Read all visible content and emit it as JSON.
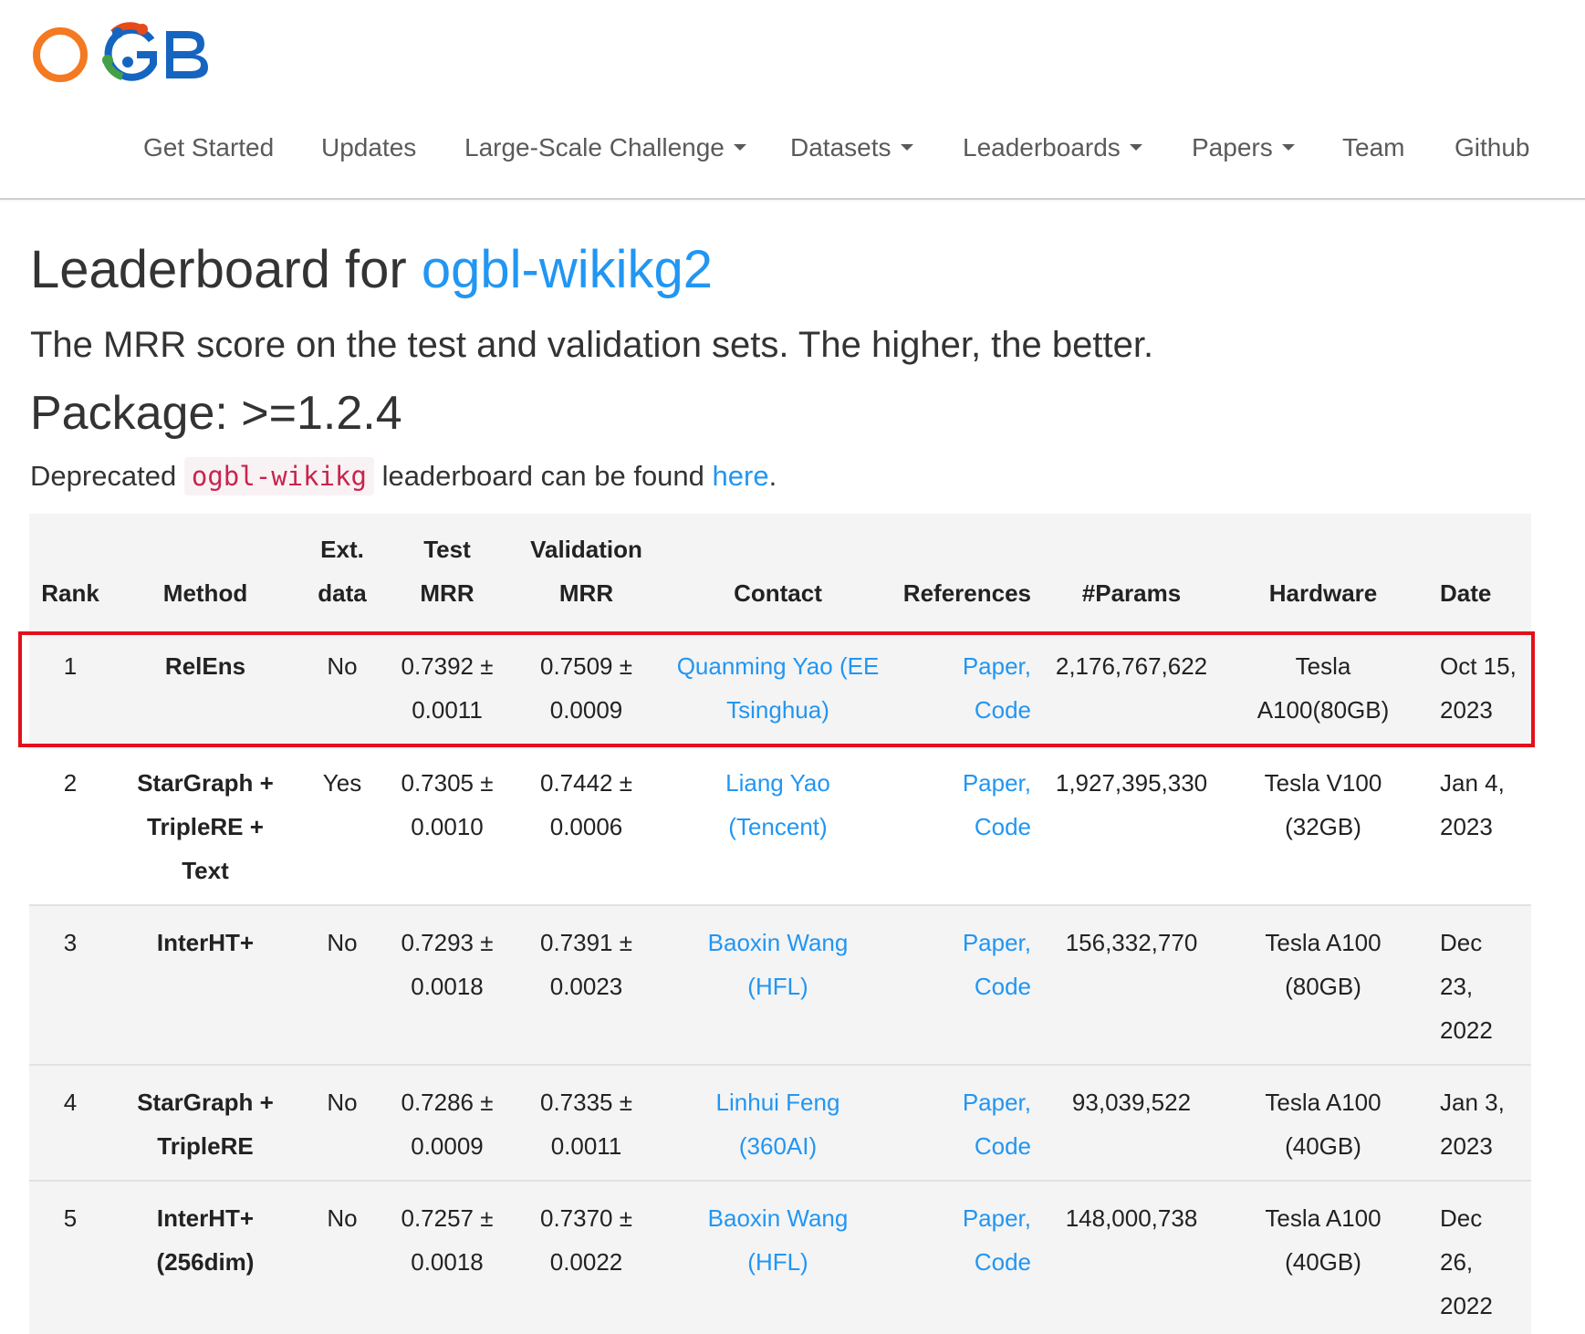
{
  "logo": {
    "text": "OGB"
  },
  "nav": {
    "items": [
      {
        "label": "Get Started",
        "dropdown": false
      },
      {
        "label": "Updates",
        "dropdown": false
      },
      {
        "label": "Large-Scale Challenge",
        "dropdown": true
      },
      {
        "label": "Datasets",
        "dropdown": true
      },
      {
        "label": "Leaderboards",
        "dropdown": true
      },
      {
        "label": "Papers",
        "dropdown": true
      },
      {
        "label": "Team",
        "dropdown": false
      },
      {
        "label": "Github",
        "dropdown": false
      }
    ]
  },
  "title": {
    "prefix": "Leaderboard for ",
    "dataset": "ogbl-wikikg2"
  },
  "subtitle": "The MRR score on the test and validation sets. The higher, the better.",
  "package": "Package: >=1.2.4",
  "deprecated": {
    "before": "Deprecated ",
    "code": "ogbl-wikikg",
    "middle": " leaderboard can be found ",
    "link": "here",
    "after": "."
  },
  "table": {
    "headers": {
      "rank": "Rank",
      "method": "Method",
      "ext_line1": "Ext.",
      "ext_line2": "data",
      "test_line1": "Test",
      "test_line2": "MRR",
      "val_line1": "Validation",
      "val_line2": "MRR",
      "contact": "Contact",
      "references": "References",
      "params": "#Params",
      "hardware": "Hardware",
      "date": "Date"
    },
    "rows": [
      {
        "rank": "1",
        "method": [
          "RelEns"
        ],
        "ext": "No",
        "test": [
          "0.7392 ±",
          "0.0011"
        ],
        "val": [
          "0.7509 ±",
          "0.0009"
        ],
        "contact": [
          "Quanming Yao (EE",
          "Tsinghua)"
        ],
        "ref_paper": "Paper,",
        "ref_code": "Code",
        "params": "2,176,767,622",
        "hardware": [
          "Tesla",
          "A100(80GB)"
        ],
        "date": [
          "Oct 15,",
          "2023"
        ]
      },
      {
        "rank": "2",
        "method": [
          "StarGraph +",
          "TripleRE +",
          "Text"
        ],
        "ext": "Yes",
        "test": [
          "0.7305 ±",
          "0.0010"
        ],
        "val": [
          "0.7442 ±",
          "0.0006"
        ],
        "contact": [
          "Liang Yao",
          "(Tencent)"
        ],
        "ref_paper": "Paper,",
        "ref_code": "Code",
        "params": "1,927,395,330",
        "hardware": [
          "Tesla V100",
          "(32GB)"
        ],
        "date": [
          "Jan 4,",
          "2023"
        ]
      },
      {
        "rank": "3",
        "method": [
          "InterHT+"
        ],
        "ext": "No",
        "test": [
          "0.7293 ±",
          "0.0018"
        ],
        "val": [
          "0.7391 ±",
          "0.0023"
        ],
        "contact": [
          "Baoxin Wang",
          "(HFL)"
        ],
        "ref_paper": "Paper,",
        "ref_code": "Code",
        "params": "156,332,770",
        "hardware": [
          "Tesla A100",
          "(80GB)"
        ],
        "date": [
          "Dec",
          "23,",
          "2022"
        ]
      },
      {
        "rank": "4",
        "method": [
          "StarGraph +",
          "TripleRE"
        ],
        "ext": "No",
        "test": [
          "0.7286 ±",
          "0.0009"
        ],
        "val": [
          "0.7335 ±",
          "0.0011"
        ],
        "contact": [
          "Linhui Feng",
          "(360AI)"
        ],
        "ref_paper": "Paper,",
        "ref_code": "Code",
        "params": "93,039,522",
        "hardware": [
          "Tesla A100",
          "(40GB)"
        ],
        "date": [
          "Jan 3,",
          "2023"
        ]
      },
      {
        "rank": "5",
        "method": [
          "InterHT+",
          "(256dim)"
        ],
        "ext": "No",
        "test": [
          "0.7257 ±",
          "0.0018"
        ],
        "val": [
          "0.7370 ±",
          "0.0022"
        ],
        "contact": [
          "Baoxin Wang",
          "(HFL)"
        ],
        "ref_paper": "Paper,",
        "ref_code": "Code",
        "params": "148,000,738",
        "hardware": [
          "Tesla A100",
          "(40GB)"
        ],
        "date": [
          "Dec",
          "26,",
          "2022"
        ]
      }
    ]
  },
  "colors": {
    "link": "#2196f3",
    "highlight_border": "#e3101a",
    "table_bg": "#f4f4f4",
    "code_text": "#c7254e",
    "code_bg": "#f9f2f4"
  }
}
